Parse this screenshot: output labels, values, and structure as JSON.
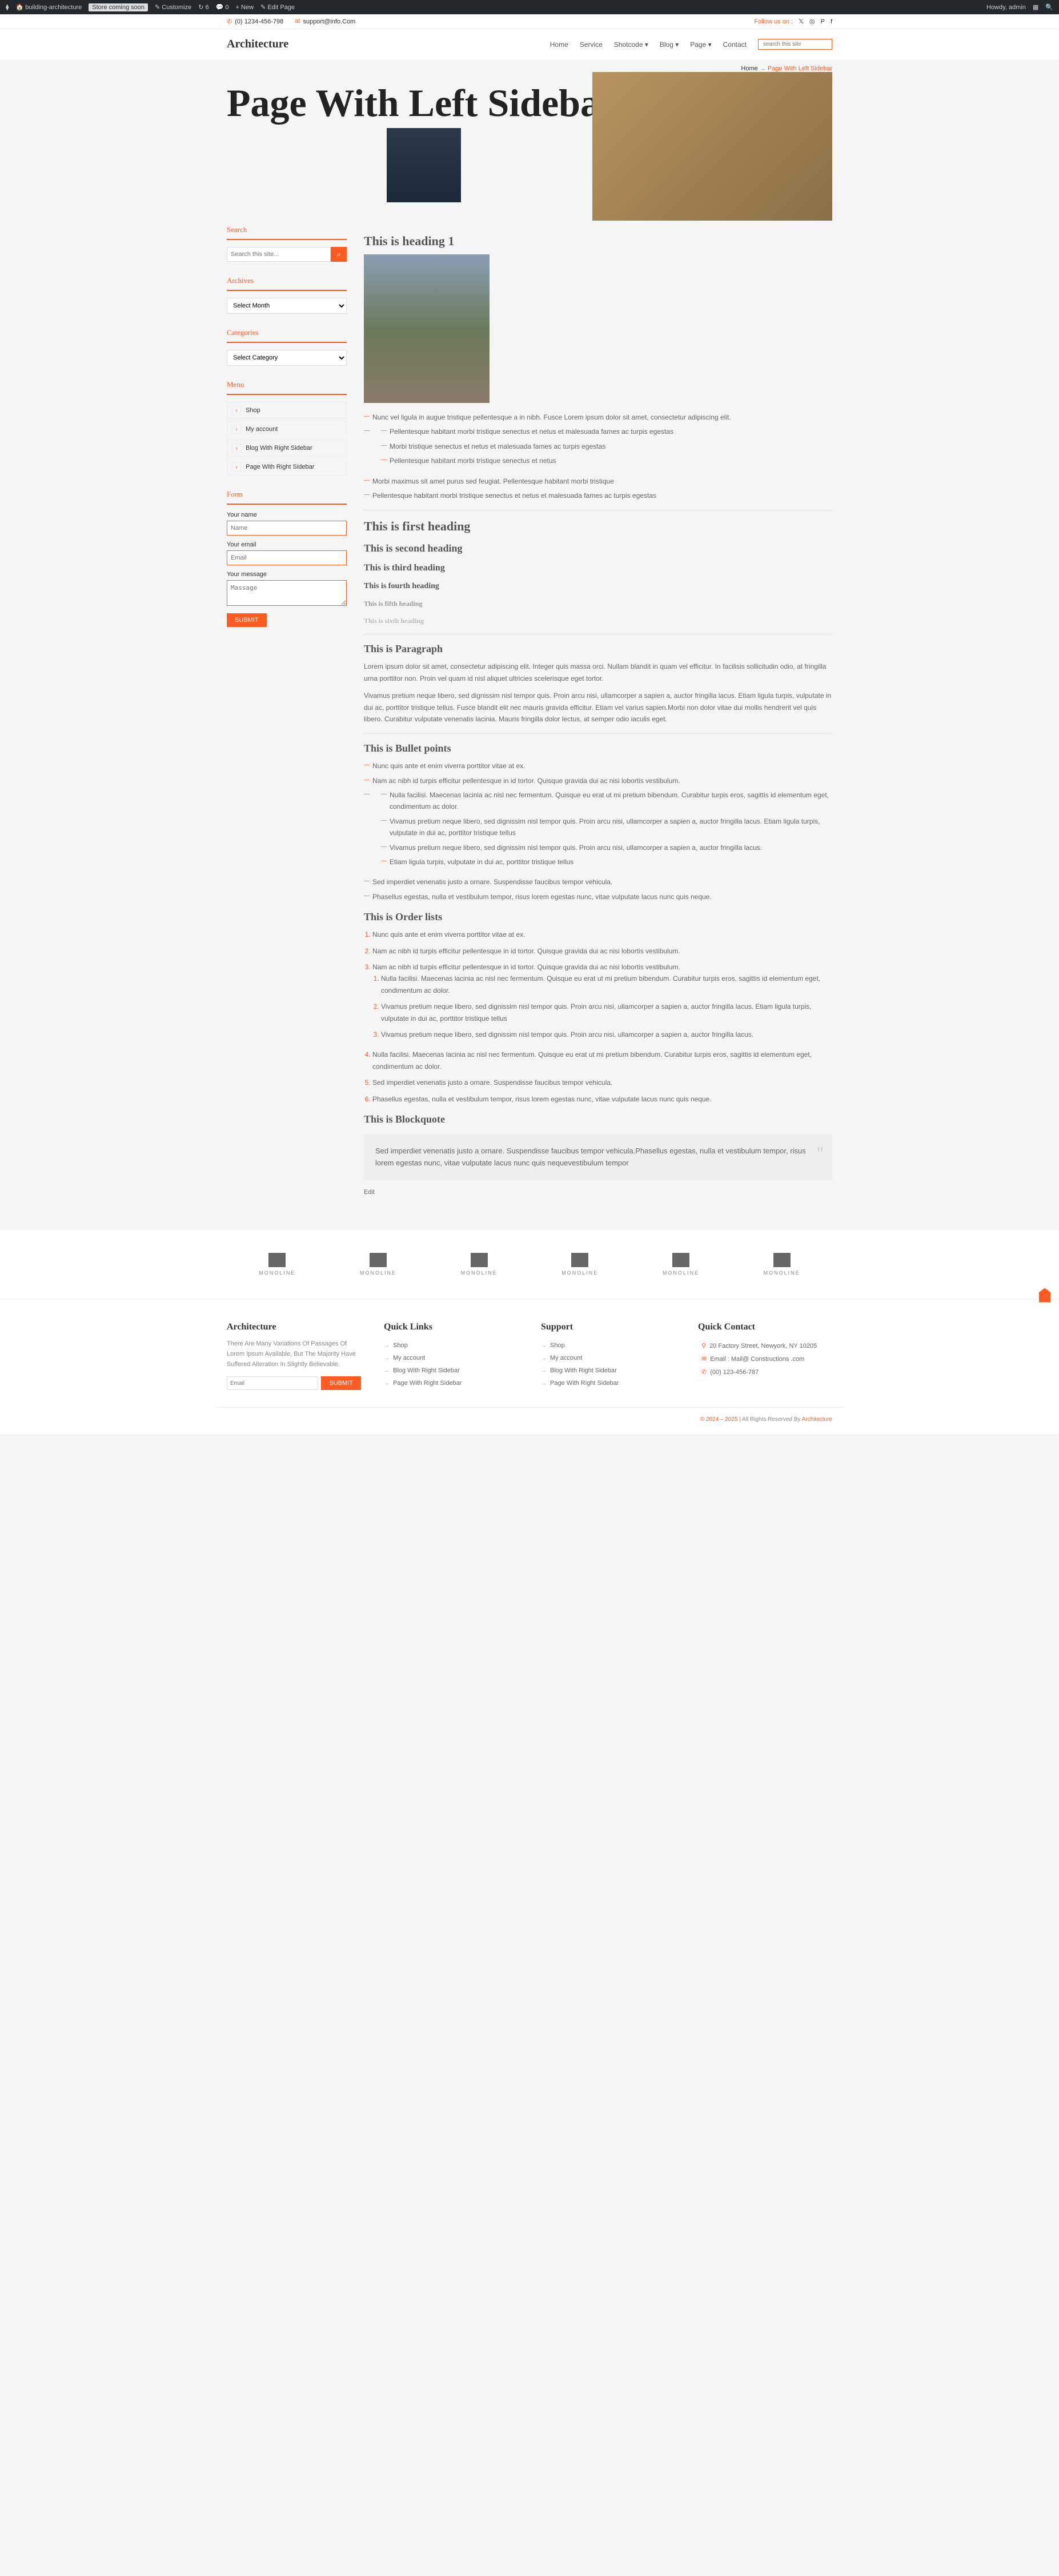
{
  "admin": {
    "site": "building-architecture",
    "store_badge": "Store coming soon",
    "customize": "Customize",
    "updates": "6",
    "comments": "0",
    "new": "New",
    "edit": "Edit Page",
    "howdy": "Howdy, admin"
  },
  "topbar": {
    "phone": "(0) 1234-456-798",
    "email": "support@info.Com",
    "follow": "Follow us on :"
  },
  "header": {
    "logo": "Architecture",
    "nav": [
      "Home",
      "Service",
      "Shotcode",
      "Blog",
      "Page",
      "Contact"
    ],
    "search_ph": "search this site"
  },
  "breadcrumb": {
    "home": "Home",
    "arrow": "→",
    "current": "Page With Left Sidebar"
  },
  "hero": {
    "title": "Page With Left Sidebar"
  },
  "sidebar": {
    "search": {
      "title": "Search",
      "ph": "Search this site..."
    },
    "archives": {
      "title": "Archives",
      "ph": "Select Month"
    },
    "categories": {
      "title": "Categories",
      "ph": "Select Category"
    },
    "menu": {
      "title": "Menu",
      "items": [
        "Shop",
        "My account",
        "Blog With Right Sidebar",
        "Page With Right Sidebar"
      ]
    },
    "form": {
      "title": "Form",
      "name_l": "Your name",
      "name_ph": "Name",
      "email_l": "Your email",
      "email_ph": "Email",
      "msg_l": "Your message",
      "msg_ph": "Massage",
      "submit": "SUBMIT"
    }
  },
  "content": {
    "h1": "This is heading 1",
    "list1": [
      "Nunc vel ligula in augue tristique pellentesque a in nibh. Fusce Lorem ipsum dolor sit amet, consectetur adipiscing elit.",
      "Pellentesque habitant morbi tristique senectus et netus et malesuada fames ac turpis egestas",
      "Morbi tristique senectus et netus et malesuada fames ac turpis egestas",
      "Pellentesque habitant morbi tristique senectus et netus",
      "Morbi maximus sit amet purus sed feugiat. Pellentesque habitant morbi tristique",
      "Pellentesque habitant morbi tristique senectus et netus et malesuada fames ac turpis egestas"
    ],
    "h_first": "This is first heading",
    "h_second": "This is second heading",
    "h_third": "This is third heading",
    "h_fourth": "This is fourth heading",
    "h_fifth": "This is fifth heading",
    "h_sixth": "This is sixth heading",
    "para_title": "This is Paragraph",
    "para1": "Lorem ipsum dolor sit amet, consectetur adipiscing elit. Integer quis massa orci. Nullam blandit in quam vel efficitur. In facilisis sollicitudin odio, at fringilla urna porttitor non. Proin vel quam id nisl aliquet ultricies scelerisque eget tortor.",
    "para2": "Vivamus pretium neque libero, sed dignissim nisl tempor quis. Proin arcu nisi, ullamcorper a sapien a, auctor fringilla lacus. Etiam ligula turpis, vulputate in dui ac, porttitor tristique tellus. Fusce blandit elit nec mauris gravida efficitur. Etiam vel varius sapien.Morbi non dolor vitae dui mollis hendrerit vel quis libero. Curabitur vulputate venenatis lacinia. Mauris fringilla dolor lectus, at semper odio iaculis eget.",
    "bullet_title": "This is Bullet points",
    "bullets": [
      "Nunc quis ante et enim viverra porttitor vitae at ex.",
      "Nam ac nibh id turpis efficitur pellentesque in id tortor. Quisque gravida dui ac nisi lobortis vestibulum.",
      "Sed imperdiet venenatis justo a ornare. Suspendisse faucibus tempor vehicula.",
      "Phasellus egestas, nulla et vestibulum tempor, risus lorem egestas nunc, vitae vulputate lacus nunc quis neque."
    ],
    "bullets_nested": [
      "Nulla facilisi. Maecenas lacinia ac nisl nec fermentum. Quisque eu erat ut mi pretium bibendum. Curabitur turpis eros, sagittis id elementum eget, condimentum ac dolor.",
      "Vivamus pretium neque libero, sed dignissim nisl tempor quis. Proin arcu nisi, ullamcorper a sapien a, auctor fringilla lacus. Etiam ligula turpis, vulputate in dui ac, porttitor tristique tellus",
      "Vivamus pretium neque libero, sed dignissim nisl tempor quis. Proin arcu nisi, ullamcorper a sapien a, auctor fringilla lacus.",
      "Etiam ligula turpis, vulputate in dui ac, porttitor tristique tellus"
    ],
    "order_title": "This is Order lists",
    "ordered": [
      "Nunc quis ante et enim viverra porttitor vitae at ex.",
      "Nam ac nibh id turpis efficitur pellentesque in id tortor. Quisque gravida dui ac nisi lobortis vestibulum.",
      "Nam ac nibh id turpis efficitur pellentesque in id tortor. Quisque gravida dui ac nisi lobortis vestibulum.",
      "Nulla facilisi. Maecenas lacinia ac nisl nec fermentum. Quisque eu erat ut mi pretium bibendum. Curabitur turpis eros, sagittis id elementum eget, condimentum ac dolor.",
      "Sed imperdiet venenatis justo a ornare. Suspendisse faucibus tempor vehicula.",
      "Phasellus egestas, nulla et vestibulum tempor, risus lorem egestas nunc, vitae vulputate lacus nunc quis neque."
    ],
    "ordered_nested": [
      "Nulla facilisi. Maecenas lacinia ac nisl nec fermentum. Quisque eu erat ut mi pretium bibendum. Curabitur turpis eros, sagittis id elementum eget, condimentum ac dolor.",
      "Vivamus pretium neque libero, sed dignissim nisl tempor quis. Proin arcu nisi, ullamcorper a sapien a, auctor fringilla lacus. Etiam ligula turpis, vulputate in dui ac, porttitor tristique tellus",
      "Vivamus pretium neque libero, sed dignissim nisl tempor quis. Proin arcu nisi, ullamcorper a sapien a, auctor fringilla lacus."
    ],
    "block_title": "This is Blockquote",
    "blockquote": "Sed imperdiet venenatis justo a ornare. Suspendisse faucibus tempor vehicula.Phasellus egestas, nulla et vestibulum tempor, risus lorem egestas nunc, vitae vulputate lacus nunc quis nequevestibulum tempor",
    "edit": "Edit"
  },
  "brand": "MONOLINE",
  "footer": {
    "about_title": "Architecture",
    "about_text": "There Are Many Variations Of Passages Of Lorem Ipsum Available, But The Majority Have Suffered Alteration In Slightly Believable.",
    "email_ph": "Email",
    "submit": "SUBMIT",
    "quick_title": "Quick Links",
    "quick": [
      "Shop",
      "My account",
      "Blog With Right Sidebar",
      "Page With Right Sidebar"
    ],
    "support_title": "Support",
    "support": [
      "Shop",
      "My account",
      "Blog With Right Sidebar",
      "Page With Right Sidebar"
    ],
    "contact_title": "Quick Contact",
    "contact": [
      "20 Factory Street, Newyork, NY 10205",
      "Email : Mail@ Constructions .com",
      "(00) 123-456-787"
    ],
    "copyright_pre": "© 2024 – 2025",
    "copyright_mid": " | All Rights Reserved By ",
    "copyright_brand": "Architecture"
  }
}
